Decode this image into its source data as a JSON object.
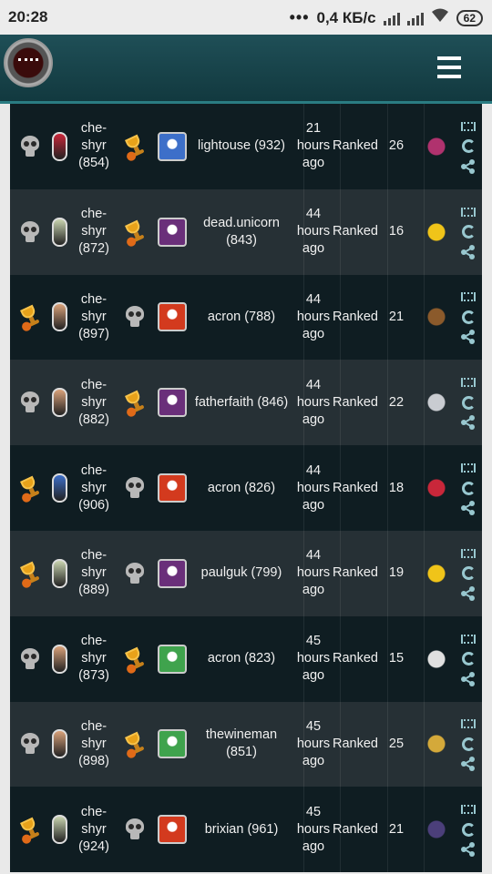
{
  "status_bar": {
    "time": "20:28",
    "dots": "•••",
    "network_speed": "0,4 КБ/с",
    "battery": "62"
  },
  "app_bar": {
    "logo_icon": "demon-mouth-logo-icon",
    "menu_icon": "hamburger-menu-icon"
  },
  "games": [
    {
      "p1_result": "loss",
      "p1_name": "che-shyr",
      "p1_rating": "(854)",
      "p1_hero_color": "#c9273a",
      "p2_result": "win",
      "p2_name": "lightouse (932)",
      "p2_avatar_color": "#3d6fc9",
      "time": "21 hours ago",
      "mode": "Ranked",
      "turns": "26",
      "card_color": "#b0326e"
    },
    {
      "p1_result": "loss",
      "p1_name": "che-shyr",
      "p1_rating": "(872)",
      "p1_hero_color": "#c9d4b0",
      "p2_result": "win",
      "p2_name": "dead.unicorn (843)",
      "p2_avatar_color": "#6a2f7a",
      "time": "44 hours ago",
      "mode": "Ranked",
      "turns": "16",
      "card_color": "#f0c419"
    },
    {
      "p1_result": "win",
      "p1_name": "che-shyr",
      "p1_rating": "(897)",
      "p1_hero_color": "#d9a27a",
      "p2_result": "loss",
      "p2_name": "acron (788)",
      "p2_avatar_color": "#d33a1e",
      "time": "44 hours ago",
      "mode": "Ranked",
      "turns": "21",
      "card_color": "#8b5a2b"
    },
    {
      "p1_result": "loss",
      "p1_name": "che-shyr",
      "p1_rating": "(882)",
      "p1_hero_color": "#d9a27a",
      "p2_result": "win",
      "p2_name": "fatherfaith (846)",
      "p2_avatar_color": "#6a2f7a",
      "time": "44 hours ago",
      "mode": "Ranked",
      "turns": "22",
      "card_color": "#c9ccd1"
    },
    {
      "p1_result": "win",
      "p1_name": "che-shyr",
      "p1_rating": "(906)",
      "p1_hero_color": "#3d6fc9",
      "p2_result": "loss",
      "p2_name": "acron (826)",
      "p2_avatar_color": "#d33a1e",
      "time": "44 hours ago",
      "mode": "Ranked",
      "turns": "18",
      "card_color": "#c9273a"
    },
    {
      "p1_result": "win",
      "p1_name": "che-shyr",
      "p1_rating": "(889)",
      "p1_hero_color": "#c9d4b0",
      "p2_result": "loss",
      "p2_name": "paulguk (799)",
      "p2_avatar_color": "#6a2f7a",
      "time": "44 hours ago",
      "mode": "Ranked",
      "turns": "19",
      "card_color": "#f0c419"
    },
    {
      "p1_result": "loss",
      "p1_name": "che-shyr",
      "p1_rating": "(873)",
      "p1_hero_color": "#d9a27a",
      "p2_result": "win",
      "p2_name": "acron (823)",
      "p2_avatar_color": "#3fa34d",
      "time": "45 hours ago",
      "mode": "Ranked",
      "turns": "15",
      "card_color": "#e0e0e0"
    },
    {
      "p1_result": "loss",
      "p1_name": "che-shyr",
      "p1_rating": "(898)",
      "p1_hero_color": "#d9a27a",
      "p2_result": "win",
      "p2_name": "thewineman (851)",
      "p2_avatar_color": "#3fa34d",
      "time": "45 hours ago",
      "mode": "Ranked",
      "turns": "25",
      "card_color": "#d4a93a"
    },
    {
      "p1_result": "win",
      "p1_name": "che-shyr",
      "p1_rating": "(924)",
      "p1_hero_color": "#c9d4b0",
      "p2_result": "loss",
      "p2_name": "brixian (961)",
      "p2_avatar_color": "#d33a1e",
      "time": "45 hours ago",
      "mode": "Ranked",
      "turns": "21",
      "card_color": "#4b3f7a"
    }
  ]
}
